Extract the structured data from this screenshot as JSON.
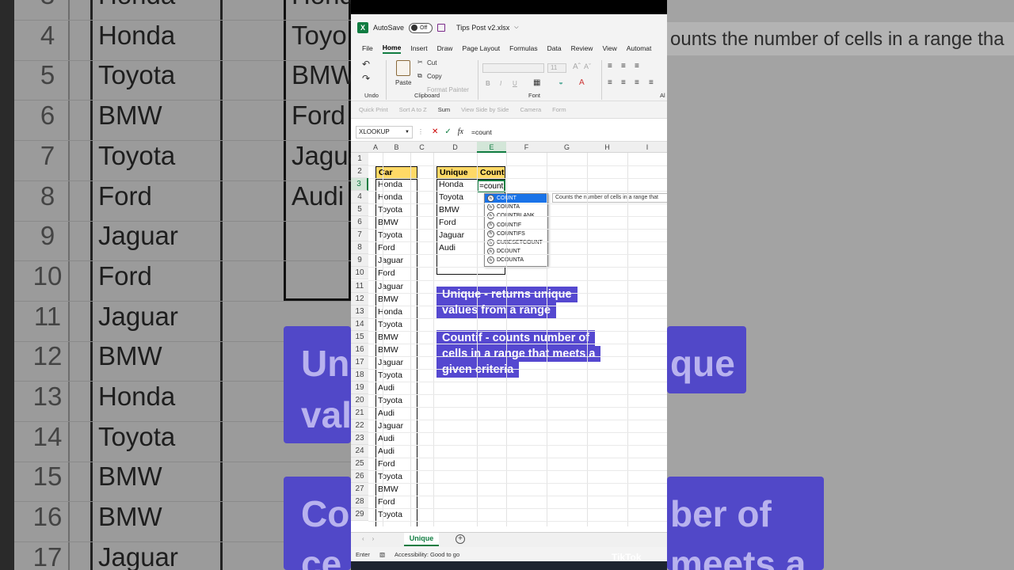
{
  "app": {
    "autosave_label": "AutoSave",
    "autosave_state": "Off",
    "file_name": "Tips Post v2.xlsx",
    "logo_letter": "X"
  },
  "menu": [
    "File",
    "Home",
    "Insert",
    "Draw",
    "Page Layout",
    "Formulas",
    "Data",
    "Review",
    "View",
    "Automat"
  ],
  "ribbon": {
    "undo_group": "Undo",
    "paste": "Paste",
    "cut": "Cut",
    "copy": "Copy",
    "format_painter": "Format Painter",
    "clipboard_group": "Clipboard",
    "font_group": "Font",
    "font_size": "11",
    "bold": "B",
    "italic": "I",
    "underline": "U",
    "align_group": "Al"
  },
  "qat": [
    "Quick Print",
    "Sort A to Z",
    "Sum",
    "View Side by Side",
    "Camera",
    "Form"
  ],
  "formula_bar": {
    "name_box": "XLOOKUP",
    "formula": "=count",
    "fx": "fx"
  },
  "columns": [
    "A",
    "B",
    "C",
    "D",
    "E",
    "F",
    "G",
    "H",
    "I"
  ],
  "rows": [
    "1",
    "2",
    "3",
    "4",
    "5",
    "6",
    "7",
    "8",
    "9",
    "10",
    "11",
    "12",
    "13",
    "14",
    "15",
    "16",
    "17",
    "18",
    "19",
    "20",
    "21",
    "22",
    "23",
    "24",
    "25",
    "26",
    "27",
    "28",
    "29"
  ],
  "table_car": {
    "header": "Car",
    "values": [
      "Honda",
      "Honda",
      "Toyota",
      "BMW",
      "Toyota",
      "Ford",
      "Jaguar",
      "Ford",
      "Jaguar",
      "BMW",
      "Honda",
      "Toyota",
      "BMW",
      "BMW",
      "Jaguar",
      "Toyota",
      "Audi",
      "Toyota",
      "Audi",
      "Jaguar",
      "Audi",
      "Audi",
      "Ford",
      "Toyota",
      "BMW",
      "Ford",
      "Toyota"
    ]
  },
  "table_unique": {
    "header_unique": "Unique",
    "header_count": "Count",
    "values": [
      "Honda",
      "Toyota",
      "BMW",
      "Ford",
      "Jaguar",
      "Audi"
    ],
    "editing_value": "=count"
  },
  "autocomplete": {
    "items": [
      "COUNT",
      "COUNTA",
      "COUNTBLANK",
      "COUNTIF",
      "COUNTIFS",
      "CUBESETCOUNT",
      "DCOUNT",
      "DCOUNTA"
    ],
    "tooltip": "Counts the number of cells in a range that"
  },
  "notes": {
    "unique_line1": "Unique - returns unique",
    "unique_line2": "values from a range",
    "countif_line1": "Countif - counts number of",
    "countif_line2": "cells in a range that meets a",
    "countif_line3": "given criteria"
  },
  "sheet_tab": "Unique",
  "status": {
    "mode": "Enter",
    "accessibility": "Accessibility: Good to go"
  },
  "watermark": "TikTok",
  "background": {
    "row_numbers": [
      "3",
      "4",
      "5",
      "6",
      "7",
      "8",
      "9",
      "10",
      "11",
      "12",
      "13",
      "14",
      "15",
      "16",
      "17"
    ],
    "car_values": [
      "Honda",
      "Honda",
      "Toyota",
      "BMW",
      "Toyota",
      "Ford",
      "Jaguar",
      "Ford",
      "Jaguar",
      "BMW",
      "Honda",
      "Toyota",
      "BMW",
      "BMW",
      "Jaguar"
    ],
    "unique_values": [
      "Hond",
      "Toyo",
      "BMW",
      "Ford",
      "Jagua",
      "Audi"
    ],
    "tooltip_text": "ounts the number of cells in a range tha",
    "note1_frag1": "Uni",
    "note1_frag2": "que",
    "note1_frag3": "val",
    "note2_frag1": "Co",
    "note2_frag2": "ber of",
    "note2_frag3": "ce",
    "note2_frag4": "meets a"
  },
  "colors": {
    "excel_green": "#107c41",
    "header_fill": "#ffd966",
    "note_purple": "#5548d0",
    "select_blue": "#1a73e8"
  }
}
